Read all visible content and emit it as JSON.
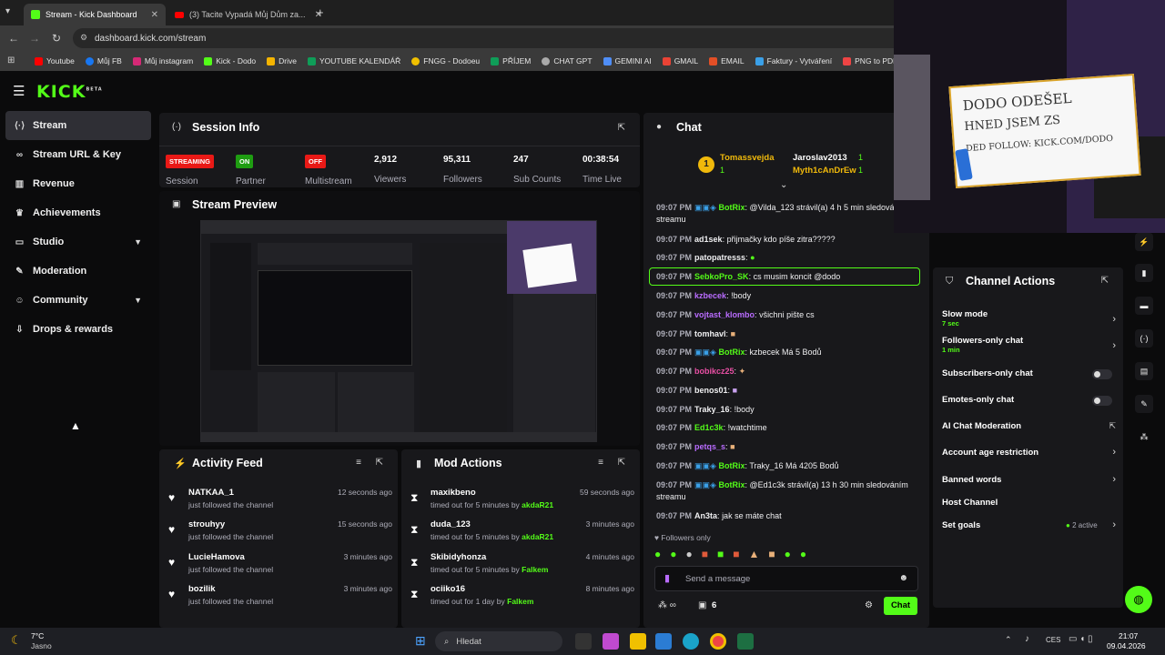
{
  "browser": {
    "tabs": [
      {
        "label": "Stream - Kick Dashboard",
        "active": true
      },
      {
        "label": "(3) Tacite Vypadá Můj Dům za...",
        "active": false
      }
    ],
    "new_tab": "+",
    "url": "dashboard.kick.com/stream",
    "bookmarks": [
      "Youtube",
      "Můj FB",
      "Můj instagram",
      "Kick - Dodo",
      "Drive",
      "YOUTUBE KALENDÁŘ",
      "FNGG - Dodoeu",
      "PŘÍJEM",
      "CHAT GPT",
      "GEMINI AI",
      "GMAIL",
      "EMAIL",
      "Faktury - Vytváření",
      "PNG to PDF"
    ]
  },
  "app": {
    "logo": "KICK",
    "logo_beta": "BETA"
  },
  "sidebar": {
    "items": [
      {
        "label": "Stream",
        "icon": "stream-icon",
        "active": true
      },
      {
        "label": "Stream URL & Key",
        "icon": "link-icon"
      },
      {
        "label": "Revenue",
        "icon": "revenue-icon"
      },
      {
        "label": "Achievements",
        "icon": "trophy-icon"
      },
      {
        "label": "Studio",
        "icon": "studio-icon",
        "expandable": true
      },
      {
        "label": "Moderation",
        "icon": "wrench-icon"
      },
      {
        "label": "Community",
        "icon": "community-icon",
        "expandable": true
      },
      {
        "label": "Drops & rewards",
        "icon": "drops-icon"
      }
    ]
  },
  "session": {
    "title": "Session Info",
    "stats": [
      {
        "badge": "STREAMING",
        "label": "Session",
        "badge_color": "#e91916"
      },
      {
        "badge": "ON",
        "label": "Partner",
        "badge_color": "#1f9d12"
      },
      {
        "badge": "OFF",
        "label": "Multistream",
        "badge_color": "#e91916"
      },
      {
        "value": "2,912",
        "label": "Viewers"
      },
      {
        "value": "95,311",
        "label": "Followers"
      },
      {
        "value": "247",
        "label": "Sub Counts"
      },
      {
        "value": "00:38:54",
        "label": "Time Live"
      }
    ]
  },
  "preview": {
    "title": "Stream Preview"
  },
  "activity": {
    "title": "Activity Feed",
    "items": [
      {
        "name": "NATKAA_1",
        "desc": "just followed the channel",
        "time": "12 seconds ago"
      },
      {
        "name": "strouhyy",
        "desc": "just followed the channel",
        "time": "15 seconds ago"
      },
      {
        "name": "LucieHamova",
        "desc": "just followed the channel",
        "time": "3 minutes ago"
      },
      {
        "name": "bozilik",
        "desc": "just followed the channel",
        "time": "3 minutes ago"
      }
    ]
  },
  "modactions": {
    "title": "Mod Actions",
    "items": [
      {
        "name": "maxikbeno",
        "desc": "timed out for 5 minutes by",
        "by": "akdaR21",
        "time": "59 seconds ago"
      },
      {
        "name": "duda_123",
        "desc": "timed out for 5 minutes by",
        "by": "akdaR21",
        "time": "3 minutes ago"
      },
      {
        "name": "Skibidyhonza",
        "desc": "timed out for 5 minutes by",
        "by": "Falkem",
        "time": "4 minutes ago"
      },
      {
        "name": "ociiko16",
        "desc": "timed out for 1 day by",
        "by": "Falkem",
        "time": "8 minutes ago"
      }
    ]
  },
  "chat": {
    "title": "Chat",
    "top": {
      "rank": "1",
      "first": "Tomassvejda",
      "first_count": "1",
      "second": "Jaroslav2013",
      "second_count": "1",
      "third": "Myth1cAnDrEw",
      "third_count": "1"
    },
    "messages": [
      {
        "time": "09:07 PM",
        "user": "BotRix",
        "color": "#53fc18",
        "text": "@Vilda_123 strávil(a) 4 h 5 min sledováním streamu",
        "badges": true
      },
      {
        "time": "09:07 PM",
        "user": "ad1sek",
        "color": "#ffffff",
        "text": "přijmačky kdo píše zitra?????"
      },
      {
        "time": "09:07 PM",
        "user": "patopatresss",
        "color": "#ffffff",
        "text": ""
      },
      {
        "time": "09:07 PM",
        "user": "SebkoPro_SK",
        "color": "#53fc18",
        "text": "cs musim koncit @dodo",
        "highlight": true
      },
      {
        "time": "09:07 PM",
        "user": "kzbecek",
        "color": "#b96cff",
        "text": "!body"
      },
      {
        "time": "09:07 PM",
        "user": "vojtast_klombo",
        "color": "#b96cff",
        "text": "všichni pište cs"
      },
      {
        "time": "09:07 PM",
        "user": "tomhavl",
        "color": "#ffffff",
        "text": ""
      },
      {
        "time": "09:07 PM",
        "user": "BotRix",
        "color": "#53fc18",
        "text": "kzbecek Má 5 Bodů",
        "badges": true
      },
      {
        "time": "09:07 PM",
        "user": "bobikcz25",
        "color": "#e84fa4",
        "text": ""
      },
      {
        "time": "09:07 PM",
        "user": "benos01",
        "color": "#ffffff",
        "text": ""
      },
      {
        "time": "09:07 PM",
        "user": "Traky_16",
        "color": "#ffffff",
        "text": "!body"
      },
      {
        "time": "09:07 PM",
        "user": "Ed1c3k",
        "color": "#53fc18",
        "text": "!watchtime"
      },
      {
        "time": "09:07 PM",
        "user": "petqs_s",
        "color": "#b96cff",
        "text": ""
      },
      {
        "time": "09:07 PM",
        "user": "BotRix",
        "color": "#53fc18",
        "text": "Traky_16 Má 4205 Bodů",
        "badges": true
      },
      {
        "time": "09:07 PM",
        "user": "BotRix",
        "color": "#53fc18",
        "text": "@Ed1c3k strávil(a) 13 h 30 min sledováním streamu",
        "badges": true
      },
      {
        "time": "09:07 PM",
        "user": "An3ta",
        "color": "#ffffff",
        "text": "jak se máte chat"
      }
    ],
    "followers_only": "Followers only",
    "placeholder": "Send a message",
    "count": "6",
    "send": "Chat"
  },
  "channel_actions": {
    "title": "Channel Actions",
    "rows": [
      {
        "label": "Slow mode",
        "sub": "7 sec",
        "ctl": "chevron"
      },
      {
        "label": "Followers-only chat",
        "sub": "1 min",
        "ctl": "chevron"
      },
      {
        "label": "Subscribers-only chat",
        "ctl": "toggle"
      },
      {
        "label": "Emotes-only chat",
        "ctl": "toggle"
      },
      {
        "label": "AI Chat Moderation",
        "ctl": "popout"
      },
      {
        "label": "Account age restriction",
        "ctl": "chevron"
      },
      {
        "label": "Banned words",
        "ctl": "chevron"
      },
      {
        "label": "Host Channel",
        "ctl": "none"
      },
      {
        "label": "Set goals",
        "ctl": "chevron",
        "extra": "2 active"
      }
    ]
  },
  "webcam": {
    "line1": "DODO ODEŠEL",
    "line2": "HNED JSEM ZS",
    "line3": "DED FOLLOW: KICK.COM/DODO"
  },
  "taskbar": {
    "temp": "7°C",
    "weather": "Jasno",
    "search": "Hledat",
    "lang": "CES",
    "time": "21:07",
    "date": "09.04.2026"
  },
  "colors": {
    "accent": "#53fc18",
    "bg": "#0b0b0c",
    "card": "#18181b"
  }
}
